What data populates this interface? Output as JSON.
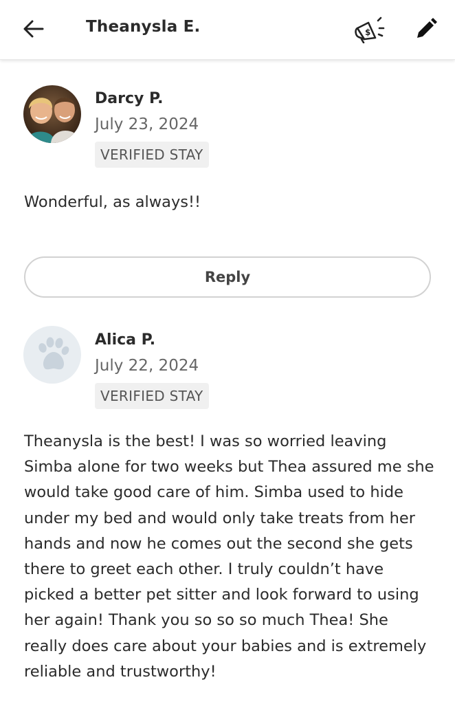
{
  "header": {
    "title": "Theanysla E.",
    "back_icon": "arrow-left-icon",
    "promo_icon": "megaphone-dollar-icon",
    "edit_icon": "pencil-icon"
  },
  "reviews": [
    {
      "name": "Darcy P.",
      "date": "July 23, 2024",
      "badge": "VERIFIED STAY",
      "text": "Wonderful, as always!!",
      "avatar": "profile-photo"
    },
    {
      "name": "Alica P.",
      "date": "July 22, 2024",
      "badge": "VERIFIED STAY",
      "text": "Theanysla is the best! I was so worried leaving Simba alone for two weeks but Thea assured me she would take good care of him. Simba used to hide under my bed and would only take treats from her hands and now he comes out the second she gets there to greet each other. I truly couldn’t have picked a better pet sitter and look forward to using her again! Thank you so so so much Thea! She really does care about your babies and is extremely reliable and trustworthy!",
      "avatar": "paw-placeholder-icon"
    }
  ],
  "reply": {
    "label": "Reply"
  },
  "colors": {
    "text": "#2b2b2b",
    "muted": "#666666",
    "badge_bg": "#f0f0f0",
    "reply_border": "#d2d2d2",
    "paw_bg": "#e8edf1",
    "paw": "#c9d3dc"
  }
}
